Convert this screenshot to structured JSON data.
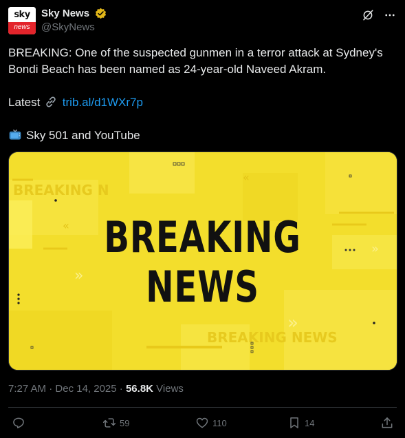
{
  "author": {
    "avatar_top": "sky",
    "avatar_bottom": "news",
    "display_name": "Sky News",
    "handle": "@SkyNews",
    "verified_color": "#e2b719"
  },
  "header_icons": [
    "grok-icon",
    "more-icon"
  ],
  "tweet": {
    "line1": "BREAKING: One of the suspected gunmen in a terror attack at Sydney's Bondi Beach has been named as 24-year-old Naveed Akram.",
    "latest_label": "Latest",
    "link_text": "trib.al/d1WXr7p",
    "tv_text": "Sky 501 and YouTube"
  },
  "media": {
    "line1": "BREAKING",
    "line2": "NEWS",
    "bg_color": "#f3de2c",
    "faint_left": "BREAKING N",
    "faint_bottom": "BREAKING NEWS"
  },
  "meta": {
    "time": "7:27 AM",
    "date": "Dec 14, 2025",
    "views_count": "56.8K",
    "views_label": "Views"
  },
  "actions": {
    "reply_count": "",
    "retweet_count": "59",
    "like_count": "110",
    "bookmark_count": "14"
  },
  "colors": {
    "background": "#000000",
    "text": "#e7e9ea",
    "secondary": "#71767b",
    "link": "#1d9bf0",
    "divider": "#2f3336"
  }
}
